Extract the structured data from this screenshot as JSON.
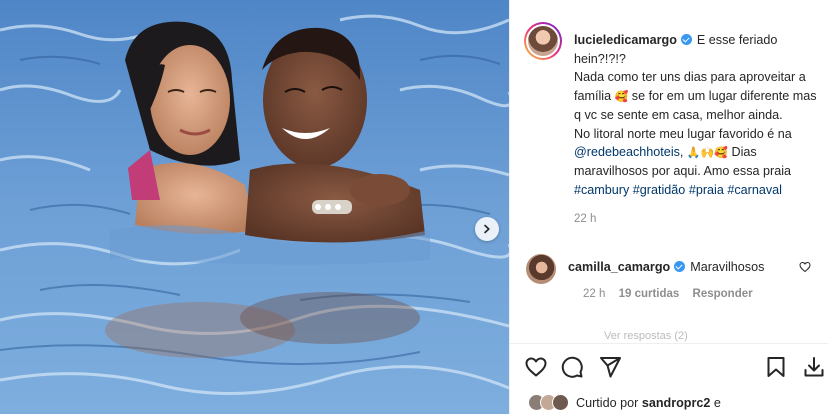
{
  "post": {
    "image_alt": "Couple in swimming pool",
    "next_icon": "chevron-right-icon"
  },
  "caption": {
    "username": "lucieledicamargo",
    "line1": "E esse feriado hein?!?!?",
    "line2a": "Nada como ter uns dias para aproveitar a família",
    "line2b": "se for em um lugar diferente mas q vc se sente em casa, melhor ainda.",
    "line3a": "No litoral norte meu lugar favorido é na",
    "mention": "@redebeachhoteis",
    "line3b": ",",
    "line3c": "Dias maravilhosos por aqui. Amo essa praia",
    "hashtags": [
      "#cambury",
      "#gratidão",
      "#praia",
      "#carnaval"
    ],
    "time": "22 h"
  },
  "comment": {
    "username": "camilla_camargo",
    "text": "Maravilhosos",
    "time": "22 h",
    "likes": "19 curtidas",
    "reply": "Responder",
    "view_replies": "Ver respostas (2)"
  },
  "actions": {
    "like": "heart-icon",
    "comment": "comment-icon",
    "share": "share-icon",
    "save": "bookmark-icon"
  },
  "likes": {
    "prefix": "Curtido por",
    "user": "sandroprc2",
    "suffix": "e"
  },
  "colors": {
    "verified": "#3897f0",
    "link": "#00376b",
    "muted": "#8e8e8e",
    "water": "#5b8fc9"
  }
}
